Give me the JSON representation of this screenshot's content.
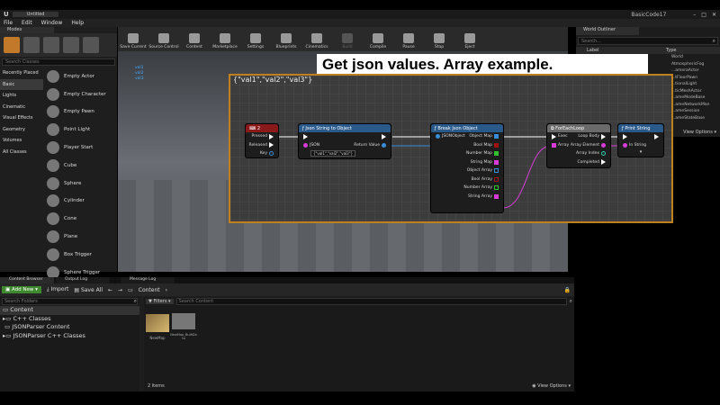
{
  "app": {
    "title_tab": "Untitled",
    "project_name": "BasicCode17",
    "menu": [
      "File",
      "Edit",
      "Window",
      "Help"
    ]
  },
  "modes": {
    "tab_label": "Modes",
    "search_placeholder": "Search Classes",
    "categories": [
      "Recently Placed",
      "Basic",
      "Lights",
      "Cinematic",
      "Visual Effects",
      "Geometry",
      "Volumes",
      "All Classes"
    ],
    "selected_category": "Basic",
    "items": [
      "Empty Actor",
      "Empty Character",
      "Empty Pawn",
      "Point Light",
      "Player Start",
      "Cube",
      "Sphere",
      "Cylinder",
      "Cone",
      "Plane",
      "Box Trigger",
      "Sphere Trigger"
    ]
  },
  "toolbar": {
    "buttons": [
      "Save Current",
      "Source Control",
      "Content",
      "Marketplace",
      "Settings",
      "Blueprints",
      "Cinematics",
      "Build",
      "Compile",
      "Pause",
      "Stop",
      "Eject"
    ]
  },
  "viewport": {
    "labels": [
      "val1",
      "val2",
      "val3"
    ]
  },
  "banner": {
    "text": "Get json values. Array example."
  },
  "blueprint": {
    "comment": "{\"val1\",\"val2\",\"val3\"}",
    "nodes": {
      "key": {
        "title": "2",
        "pins": [
          "Pressed",
          "Released",
          "Key"
        ]
      },
      "json_string": {
        "title": "Json String to Object",
        "input_label": "JSON",
        "input_value": "{\"val1\",\"val2\",\"val3\"}",
        "output": "Return Value"
      },
      "break_json": {
        "title": "Break Json Object",
        "input": "JSONObject",
        "outputs": [
          "Object Map",
          "Bool Map",
          "Number Map",
          "String Map",
          "Object Array",
          "Bool Array",
          "Number Array",
          "String Array"
        ]
      },
      "foreach": {
        "title": "ForEachLoop",
        "inputs": [
          "Exec",
          "Array"
        ],
        "outputs": [
          "Loop Body",
          "Array Element",
          "Array Index",
          "Completed"
        ]
      },
      "print": {
        "title": "Print String",
        "input": "In String"
      }
    }
  },
  "world_outliner": {
    "tab_label": "World Outliner",
    "search_placeholder": "Search...",
    "col_label": "Label",
    "col_type": "Type",
    "types": [
      "World",
      "AtmosphericFog",
      "...ameraActor",
      "...tFloorPawn",
      "...tionalLight",
      "...ticMeshActor",
      "...ameModeBase",
      "...ameNetworkMan",
      "...ameSession",
      "...ameStateBase"
    ],
    "view_options": "View Options"
  },
  "content_browser": {
    "tabs": [
      "Content Browser",
      "Output Log",
      "Message Log"
    ],
    "add_new": "Add New",
    "import": "Import",
    "save_all": "Save All",
    "path": "Content",
    "search_folders": "Search Folders",
    "filters": "Filters",
    "search_content": "Search Content",
    "tree": [
      "Content",
      "C++ Classes",
      "JSONParser Content",
      "JSONParser C++ Classes"
    ],
    "assets": [
      {
        "name": "NewMap"
      },
      {
        "name": "NewMap_BuiltData"
      }
    ],
    "item_count": "2 items",
    "view_options": "View Options"
  }
}
